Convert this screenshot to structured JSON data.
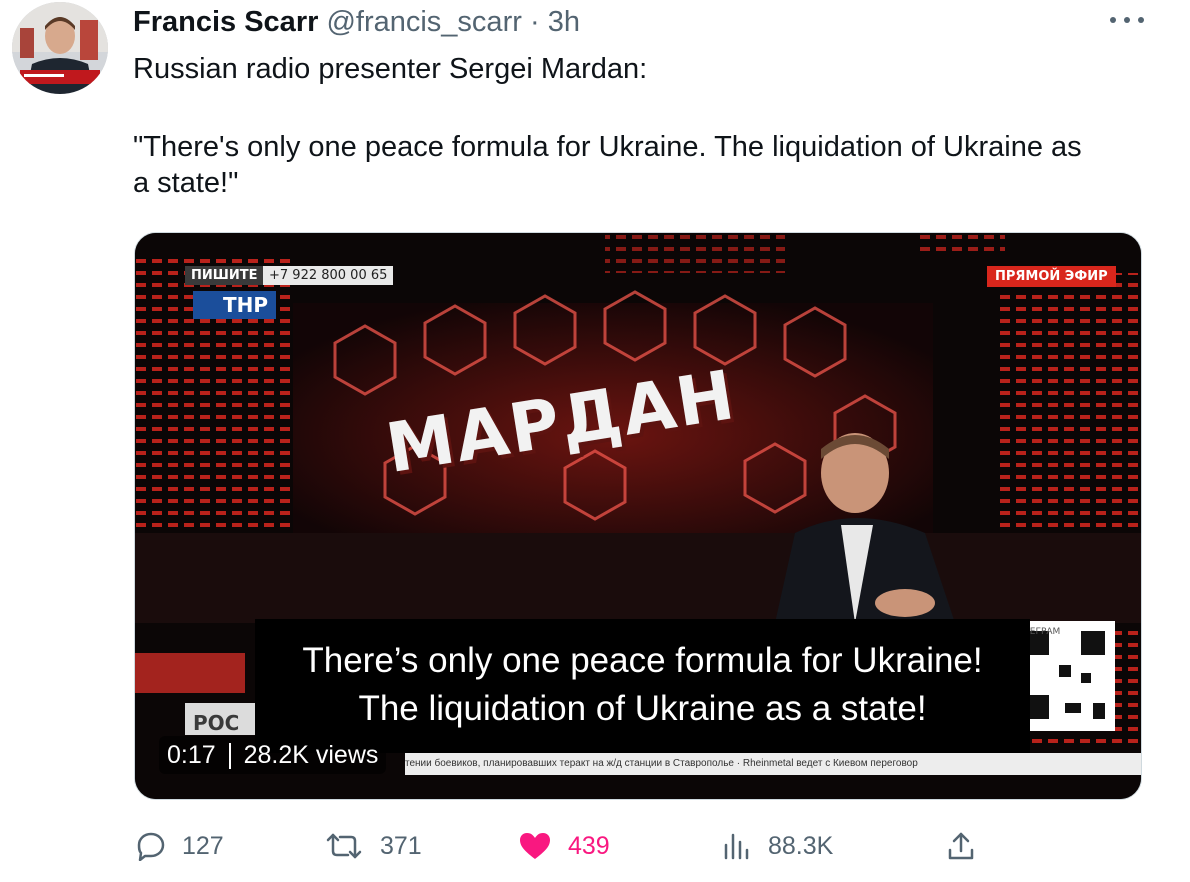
{
  "tweet": {
    "author_name": "Francis Scarr",
    "author_handle": "@francis_scarr",
    "separator": "·",
    "time": "3h",
    "text_line1": "Russian radio presenter Sergei Mardan:",
    "text_line2": "\"There's only one peace formula for Ukraine. The liquidation of Ukraine as",
    "text_line3": "a state!\""
  },
  "video": {
    "write_label": "ПИШИТЕ",
    "phone": "+7 922 800 00 65",
    "channel": "THP",
    "live_label": "ПРЯМОЙ ЭФИР",
    "show_name": "МАРДАН",
    "subtitle_line1": "There’s only one peace formula for Ukraine!",
    "subtitle_line2": "The liquidation of Ukraine as a state!",
    "ticker_text": "тении боевиков, планировавших теракт на ж/д станции в Ставрополье · Rheinmetal ведет с Киевом переговор",
    "telegram_label": "ЛЕГРАМ",
    "lower_left_label": "РОС",
    "elapsed": "0:17",
    "views": "28.2K views"
  },
  "actions": {
    "replies": "127",
    "retweets": "371",
    "likes": "439",
    "views": "88.3K"
  },
  "colors": {
    "like": "#f91880",
    "muted": "#536471",
    "text": "#0f1419",
    "studio_red": "#e8322c",
    "live_badge": "#d9261c"
  },
  "icons": [
    "more-icon",
    "reply-icon",
    "retweet-icon",
    "heart-icon",
    "analytics-icon",
    "share-icon"
  ]
}
